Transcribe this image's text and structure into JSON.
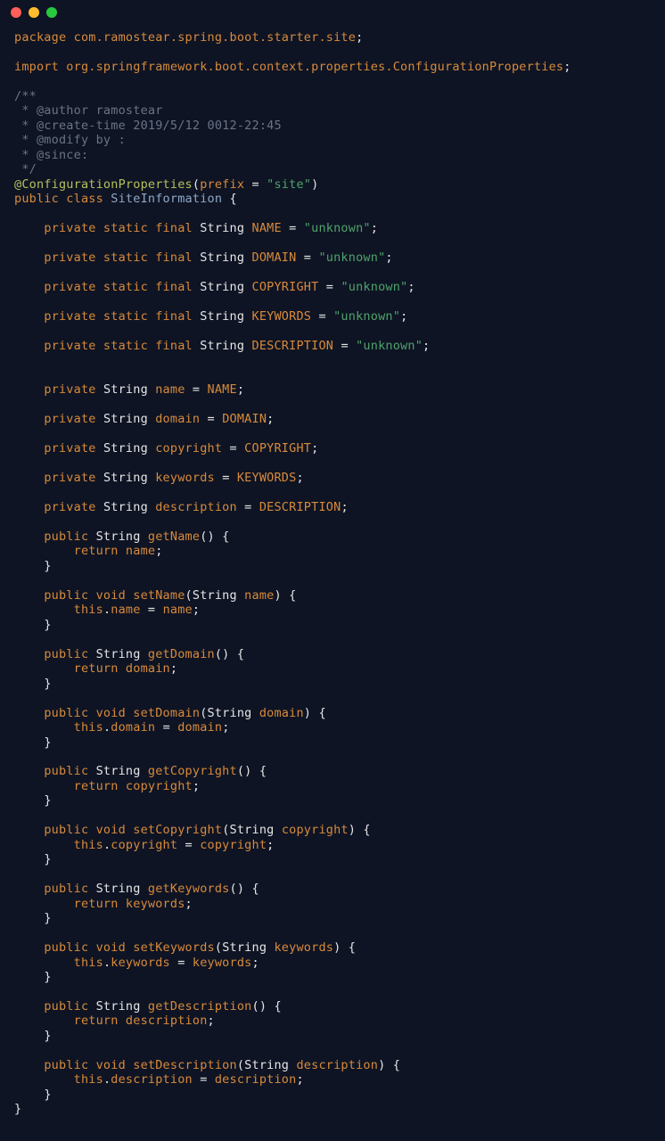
{
  "pkg_line": {
    "kw": "package",
    "path": "com.ramostear.spring.boot.starter.site"
  },
  "imp_line": {
    "kw": "import",
    "path": "org.springframework.boot.context.properties.ConfigurationProperties"
  },
  "doc": {
    "l1": "/**",
    "l2": " * @author ramostear",
    "l3": " * @create-time 2019/5/12 0012-22:45",
    "l4": " * @modify by :",
    "l5": " * @since:",
    "l6": " */"
  },
  "ann": {
    "name": "@ConfigurationProperties",
    "param": "prefix",
    "val": "\"site\""
  },
  "cls_decl": {
    "mod": "public class",
    "name": "SiteInformation"
  },
  "consts": [
    {
      "mods": "private static final",
      "type": "String",
      "name": "NAME",
      "val": "\"unknown\""
    },
    {
      "mods": "private static final",
      "type": "String",
      "name": "DOMAIN",
      "val": "\"unknown\""
    },
    {
      "mods": "private static final",
      "type": "String",
      "name": "COPYRIGHT",
      "val": "\"unknown\""
    },
    {
      "mods": "private static final",
      "type": "String",
      "name": "KEYWORDS",
      "val": "\"unknown\""
    },
    {
      "mods": "private static final",
      "type": "String",
      "name": "DESCRIPTION",
      "val": "\"unknown\""
    }
  ],
  "fields": [
    {
      "mods": "private",
      "type": "String",
      "name": "name",
      "init": "NAME"
    },
    {
      "mods": "private",
      "type": "String",
      "name": "domain",
      "init": "DOMAIN"
    },
    {
      "mods": "private",
      "type": "String",
      "name": "copyright",
      "init": "COPYRIGHT"
    },
    {
      "mods": "private",
      "type": "String",
      "name": "keywords",
      "init": "KEYWORDS"
    },
    {
      "mods": "private",
      "type": "String",
      "name": "description",
      "init": "DESCRIPTION"
    }
  ],
  "methods": {
    "getName": {
      "sig_pre": "public",
      "ret": "String",
      "name": "getName",
      "params": "",
      "body_kw": "return",
      "body_id": "name"
    },
    "setName": {
      "sig_pre": "public",
      "ret": "void",
      "name": "setName",
      "params": "String name",
      "body_lhs": "this.name",
      "body_rhs": "name"
    },
    "getDomain": {
      "sig_pre": "public",
      "ret": "String",
      "name": "getDomain",
      "params": "",
      "body_kw": "return",
      "body_id": "domain"
    },
    "setDomain": {
      "sig_pre": "public",
      "ret": "void",
      "name": "setDomain",
      "params": "String domain",
      "body_lhs": "this.domain",
      "body_rhs": "domain"
    },
    "getCopyright": {
      "sig_pre": "public",
      "ret": "String",
      "name": "getCopyright",
      "params": "",
      "body_kw": "return",
      "body_id": "copyright"
    },
    "setCopyright": {
      "sig_pre": "public",
      "ret": "void",
      "name": "setCopyright",
      "params": "String copyright",
      "body_lhs": "this.copyright",
      "body_rhs": "copyright"
    },
    "getKeywords": {
      "sig_pre": "public",
      "ret": "String",
      "name": "getKeywords",
      "params": "",
      "body_kw": "return",
      "body_id": "keywords"
    },
    "setKeywords": {
      "sig_pre": "public",
      "ret": "void",
      "name": "setKeywords",
      "params": "String keywords",
      "body_lhs": "this.keywords",
      "body_rhs": "keywords"
    },
    "getDescription": {
      "sig_pre": "public",
      "ret": "String",
      "name": "getDescription",
      "params": "",
      "body_kw": "return",
      "body_id": "description"
    },
    "setDescription": {
      "sig_pre": "public",
      "ret": "void",
      "name": "setDescription",
      "params": "String description",
      "body_lhs": "this.description",
      "body_rhs": "description"
    }
  }
}
